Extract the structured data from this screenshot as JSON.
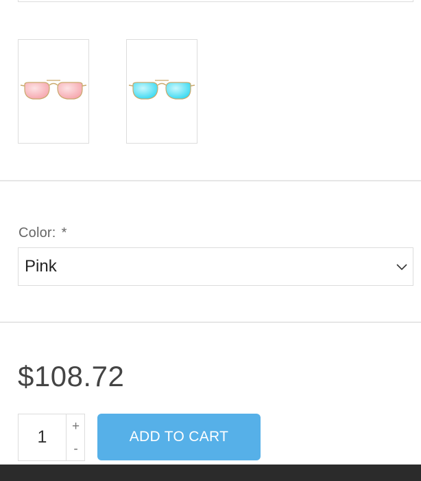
{
  "gallery": {
    "thumbnails": [
      {
        "alt": "Pink lens sunglasses",
        "lens_color": "#f5a0a8",
        "lens_highlight": "#fde2e4",
        "frame_color": "#c9a86a"
      },
      {
        "alt": "Blue lens sunglasses",
        "lens_color": "#2ad6f0",
        "lens_highlight": "#c8f7fd",
        "frame_color": "#c9a86a"
      }
    ]
  },
  "options": {
    "color_label": "Color:",
    "required_mark": "*",
    "selected_value": "Pink"
  },
  "product": {
    "price": "$108.72"
  },
  "cart": {
    "quantity": "1",
    "increment_label": "+",
    "decrement_label": "-",
    "add_to_cart_label": "ADD TO CART"
  },
  "colors": {
    "accent": "#56b0e8",
    "border": "#dcdcdc",
    "divider": "#e6e6e6",
    "footer": "#2b2b2b"
  }
}
